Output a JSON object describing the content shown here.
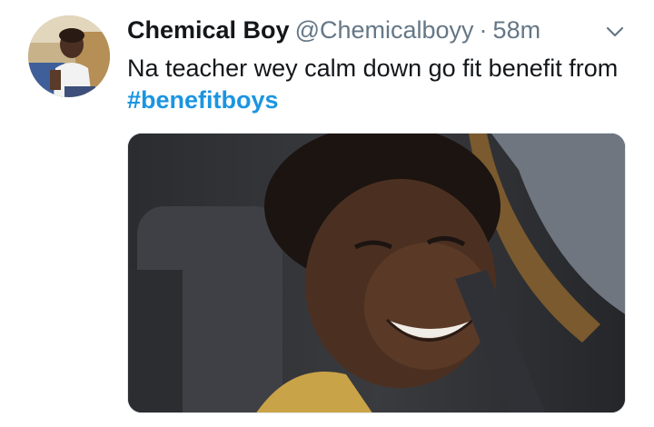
{
  "tweet": {
    "display_name": "Chemical Boy",
    "handle": "@Chemicalboyy",
    "separator": "·",
    "time": "58m",
    "text": "Na teacher wey calm down go fit benefit from ",
    "hashtag": "#benefitboys"
  },
  "icons": {
    "menu": "chevron-down-icon"
  },
  "colors": {
    "name": "#14171a",
    "secondary": "#657786",
    "hashtag": "#1b95e0"
  }
}
